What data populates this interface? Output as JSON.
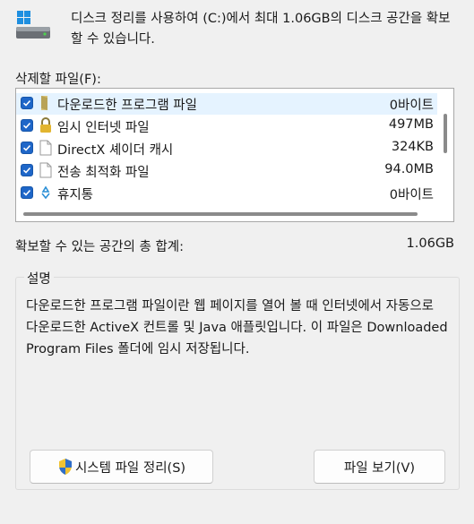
{
  "intro": {
    "text": "디스크 정리를 사용하여 (C:)에서 최대 1.06GB의 디스크 공간을 확보할 수 있습니다."
  },
  "files_label": "삭제할 파일(F):",
  "files": [
    {
      "name": "다운로드한 프로그램 파일",
      "size": "0바이트",
      "checked": true,
      "icon": "folder-icon"
    },
    {
      "name": "임시 인터넷 파일",
      "size": "497MB",
      "checked": true,
      "icon": "lock-icon"
    },
    {
      "name": "DirectX 셰이더 캐시",
      "size": "324KB",
      "checked": true,
      "icon": "file-icon"
    },
    {
      "name": "전송 최적화 파일",
      "size": "94.0MB",
      "checked": true,
      "icon": "file-icon"
    },
    {
      "name": "휴지통",
      "size": "0바이트",
      "checked": true,
      "icon": "recycle-bin-icon"
    }
  ],
  "total": {
    "label": "확보할 수 있는 공간의 총 합계:",
    "value": "1.06GB"
  },
  "description": {
    "title": "설명",
    "text": "다운로드한 프로그램 파일이란 웹 페이지를 열어 볼 때 인터넷에서 자동으로 다운로드한 ActiveX 컨트롤 및 Java 애플릿입니다. 이 파일은 Downloaded Program Files 폴더에 임시 저장됩니다."
  },
  "buttons": {
    "system_clean": "시스템 파일 정리(S)",
    "view_files": "파일 보기(V)"
  },
  "colors": {
    "accent": "#1e66c8",
    "selection": "#e5f3ff"
  }
}
